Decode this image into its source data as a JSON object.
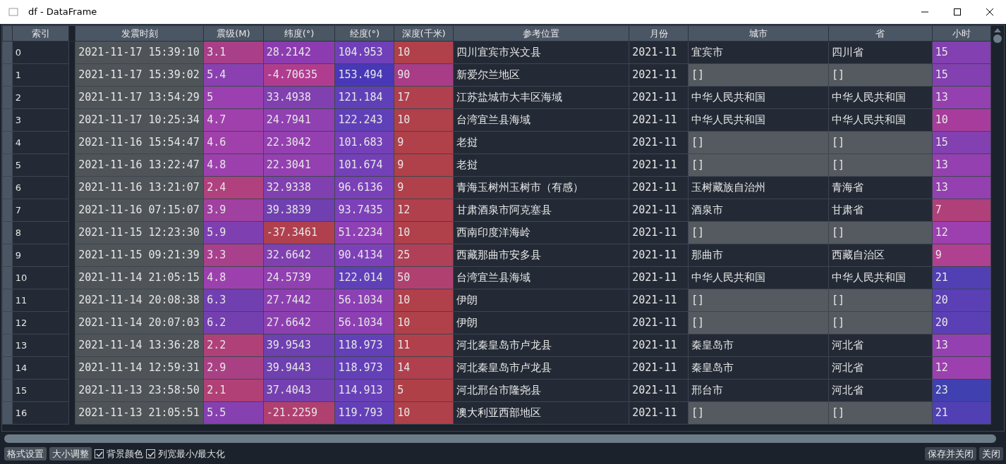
{
  "window": {
    "title": "df - DataFrame"
  },
  "index_header": "索引",
  "columns": [
    "发震时刻",
    "震级(M)",
    "纬度(°)",
    "经度(°)",
    "深度(千米)",
    "参考位置",
    "月份",
    "城市",
    "省",
    "小时"
  ],
  "rows": [
    {
      "index": "0",
      "cells": [
        {
          "text": "2021-11-17 15:39:10",
          "color": "#4e5458"
        },
        {
          "text": "3.1",
          "color": "#a83f88"
        },
        {
          "text": "28.2142",
          "color": "#8c3cb0"
        },
        {
          "text": "104.953",
          "color": "#7040b8"
        },
        {
          "text": "10",
          "color": "#b0404a"
        },
        {
          "text": "四川宜宾市兴文县",
          "color": "#232a35"
        },
        {
          "text": "2021-11",
          "color": "#232a35"
        },
        {
          "text": "宜宾市",
          "color": "#232a35"
        },
        {
          "text": "四川省",
          "color": "#232a35"
        },
        {
          "text": "15",
          "color": "#8240b0"
        }
      ]
    },
    {
      "index": "1",
      "cells": [
        {
          "text": "2021-11-17 15:39:02",
          "color": "#4e5458"
        },
        {
          "text": "5.4",
          "color": "#8a40b0"
        },
        {
          "text": "-4.70635",
          "color": "#b03c90"
        },
        {
          "text": "153.494",
          "color": "#4838b8"
        },
        {
          "text": "90",
          "color": "#a83c86"
        },
        {
          "text": "新爱尔兰地区",
          "color": "#232a35"
        },
        {
          "text": "2021-11",
          "color": "#232a35"
        },
        {
          "text": "[]",
          "color": "#545a60"
        },
        {
          "text": "[]",
          "color": "#545a60"
        },
        {
          "text": "15",
          "color": "#8240b0"
        }
      ]
    },
    {
      "index": "2",
      "cells": [
        {
          "text": "2021-11-17 13:54:29",
          "color": "#4e5458"
        },
        {
          "text": "5",
          "color": "#9a40b0"
        },
        {
          "text": "33.4938",
          "color": "#8040b0"
        },
        {
          "text": "121.184",
          "color": "#6040b8"
        },
        {
          "text": "17",
          "color": "#b0404e"
        },
        {
          "text": "江苏盐城市大丰区海域",
          "color": "#232a35"
        },
        {
          "text": "2021-11",
          "color": "#232a35"
        },
        {
          "text": "中华人民共和国",
          "color": "#232a35"
        },
        {
          "text": "中华人民共和国",
          "color": "#232a35"
        },
        {
          "text": "13",
          "color": "#9440b0"
        }
      ]
    },
    {
      "index": "3",
      "cells": [
        {
          "text": "2021-11-17 10:25:34",
          "color": "#4e5458"
        },
        {
          "text": "4.7",
          "color": "#a040ac"
        },
        {
          "text": "24.7941",
          "color": "#9040b0"
        },
        {
          "text": "122.243",
          "color": "#6040b8"
        },
        {
          "text": "10",
          "color": "#b0404a"
        },
        {
          "text": "台湾宜兰县海域",
          "color": "#232a35"
        },
        {
          "text": "2021-11",
          "color": "#232a35"
        },
        {
          "text": "中华人民共和国",
          "color": "#232a35"
        },
        {
          "text": "中华人民共和国",
          "color": "#232a35"
        },
        {
          "text": "10",
          "color": "#a83c9c"
        }
      ]
    },
    {
      "index": "4",
      "cells": [
        {
          "text": "2021-11-16 15:54:47",
          "color": "#4e5458"
        },
        {
          "text": "4.6",
          "color": "#a040aa"
        },
        {
          "text": "22.3042",
          "color": "#9440b0"
        },
        {
          "text": "101.683",
          "color": "#7440b8"
        },
        {
          "text": "9",
          "color": "#b0404a"
        },
        {
          "text": "老挝",
          "color": "#232a35"
        },
        {
          "text": "2021-11",
          "color": "#232a35"
        },
        {
          "text": "[]",
          "color": "#545a60"
        },
        {
          "text": "[]",
          "color": "#545a60"
        },
        {
          "text": "15",
          "color": "#8240b0"
        }
      ]
    },
    {
      "index": "5",
      "cells": [
        {
          "text": "2021-11-16 13:22:47",
          "color": "#4e5458"
        },
        {
          "text": "4.8",
          "color": "#9c40ae"
        },
        {
          "text": "22.3041",
          "color": "#9440b0"
        },
        {
          "text": "101.674",
          "color": "#7440b8"
        },
        {
          "text": "9",
          "color": "#b0404a"
        },
        {
          "text": "老挝",
          "color": "#232a35"
        },
        {
          "text": "2021-11",
          "color": "#232a35"
        },
        {
          "text": "[]",
          "color": "#545a60"
        },
        {
          "text": "[]",
          "color": "#545a60"
        },
        {
          "text": "13",
          "color": "#9440b0"
        }
      ]
    },
    {
      "index": "6",
      "cells": [
        {
          "text": "2021-11-16 13:21:07",
          "color": "#4e5458"
        },
        {
          "text": "2.4",
          "color": "#b0407e"
        },
        {
          "text": "32.9338",
          "color": "#8040b0"
        },
        {
          "text": "96.6136",
          "color": "#7a40b8"
        },
        {
          "text": "9",
          "color": "#b0404a"
        },
        {
          "text": "青海玉树州玉树市（有感）",
          "color": "#232a35"
        },
        {
          "text": "2021-11",
          "color": "#232a35"
        },
        {
          "text": "玉树藏族自治州",
          "color": "#232a35"
        },
        {
          "text": "青海省",
          "color": "#232a35"
        },
        {
          "text": "13",
          "color": "#9440b0"
        }
      ]
    },
    {
      "index": "7",
      "cells": [
        {
          "text": "2021-11-16 07:15:07",
          "color": "#4e5458"
        },
        {
          "text": "3.9",
          "color": "#a040a0"
        },
        {
          "text": "39.3839",
          "color": "#7040b0"
        },
        {
          "text": "93.7435",
          "color": "#7c40b8"
        },
        {
          "text": "12",
          "color": "#b0404c"
        },
        {
          "text": "甘肃酒泉市阿克塞县",
          "color": "#232a35"
        },
        {
          "text": "2021-11",
          "color": "#232a35"
        },
        {
          "text": "酒泉市",
          "color": "#232a35"
        },
        {
          "text": "甘肃省",
          "color": "#232a35"
        },
        {
          "text": "7",
          "color": "#b0407a"
        }
      ]
    },
    {
      "index": "8",
      "cells": [
        {
          "text": "2021-11-15 12:23:30",
          "color": "#4e5458"
        },
        {
          "text": "5.9",
          "color": "#7e40b0"
        },
        {
          "text": "-37.3461",
          "color": "#b0404e"
        },
        {
          "text": "51.2234",
          "color": "#8e40b4"
        },
        {
          "text": "10",
          "color": "#b0404a"
        },
        {
          "text": "西南印度洋海岭",
          "color": "#232a35"
        },
        {
          "text": "2021-11",
          "color": "#232a35"
        },
        {
          "text": "[]",
          "color": "#545a60"
        },
        {
          "text": "[]",
          "color": "#545a60"
        },
        {
          "text": "12",
          "color": "#9c40b0"
        }
      ]
    },
    {
      "index": "9",
      "cells": [
        {
          "text": "2021-11-15 09:21:39",
          "color": "#4e5458"
        },
        {
          "text": "3.3",
          "color": "#a8408c"
        },
        {
          "text": "32.6642",
          "color": "#8040b0"
        },
        {
          "text": "90.4134",
          "color": "#7e40b8"
        },
        {
          "text": "25",
          "color": "#b04058"
        },
        {
          "text": "西藏那曲市安多县",
          "color": "#232a35"
        },
        {
          "text": "2021-11",
          "color": "#232a35"
        },
        {
          "text": "那曲市",
          "color": "#232a35"
        },
        {
          "text": "西藏自治区",
          "color": "#232a35"
        },
        {
          "text": "9",
          "color": "#b04090"
        }
      ]
    },
    {
      "index": "10",
      "cells": [
        {
          "text": "2021-11-14 21:05:15",
          "color": "#4e5458"
        },
        {
          "text": "4.8",
          "color": "#9c40ae"
        },
        {
          "text": "24.5739",
          "color": "#9040b0"
        },
        {
          "text": "122.014",
          "color": "#6040b8"
        },
        {
          "text": "50",
          "color": "#b04070"
        },
        {
          "text": "台湾宜兰县海域",
          "color": "#232a35"
        },
        {
          "text": "2021-11",
          "color": "#232a35"
        },
        {
          "text": "中华人民共和国",
          "color": "#232a35"
        },
        {
          "text": "中华人民共和国",
          "color": "#232a35"
        },
        {
          "text": "21",
          "color": "#5040b4"
        }
      ]
    },
    {
      "index": "11",
      "cells": [
        {
          "text": "2021-11-14 20:08:38",
          "color": "#4e5458"
        },
        {
          "text": "6.3",
          "color": "#7040b0"
        },
        {
          "text": "27.7442",
          "color": "#8c40b0"
        },
        {
          "text": "56.1034",
          "color": "#8c40b4"
        },
        {
          "text": "10",
          "color": "#b0404a"
        },
        {
          "text": "伊朗",
          "color": "#232a35"
        },
        {
          "text": "2021-11",
          "color": "#232a35"
        },
        {
          "text": "[]",
          "color": "#545a60"
        },
        {
          "text": "[]",
          "color": "#545a60"
        },
        {
          "text": "20",
          "color": "#5a40b4"
        }
      ]
    },
    {
      "index": "12",
      "cells": [
        {
          "text": "2021-11-14 20:07:03",
          "color": "#4e5458"
        },
        {
          "text": "6.2",
          "color": "#7440b0"
        },
        {
          "text": "27.6642",
          "color": "#8c40b0"
        },
        {
          "text": "56.1034",
          "color": "#8c40b4"
        },
        {
          "text": "10",
          "color": "#b0404a"
        },
        {
          "text": "伊朗",
          "color": "#232a35"
        },
        {
          "text": "2021-11",
          "color": "#232a35"
        },
        {
          "text": "[]",
          "color": "#545a60"
        },
        {
          "text": "[]",
          "color": "#545a60"
        },
        {
          "text": "20",
          "color": "#5a40b4"
        }
      ]
    },
    {
      "index": "13",
      "cells": [
        {
          "text": "2021-11-14 13:36:28",
          "color": "#4e5458"
        },
        {
          "text": "2.2",
          "color": "#b04078"
        },
        {
          "text": "39.9543",
          "color": "#6e40b0"
        },
        {
          "text": "118.973",
          "color": "#6440b8"
        },
        {
          "text": "11",
          "color": "#b0404b"
        },
        {
          "text": "河北秦皇岛市卢龙县",
          "color": "#232a35"
        },
        {
          "text": "2021-11",
          "color": "#232a35"
        },
        {
          "text": "秦皇岛市",
          "color": "#232a35"
        },
        {
          "text": "河北省",
          "color": "#232a35"
        },
        {
          "text": "13",
          "color": "#9440b0"
        }
      ]
    },
    {
      "index": "14",
      "cells": [
        {
          "text": "2021-11-14 12:59:31",
          "color": "#4e5458"
        },
        {
          "text": "2.9",
          "color": "#aa4084"
        },
        {
          "text": "39.9443",
          "color": "#6e40b0"
        },
        {
          "text": "118.973",
          "color": "#6440b8"
        },
        {
          "text": "14",
          "color": "#b0404d"
        },
        {
          "text": "河北秦皇岛市卢龙县",
          "color": "#232a35"
        },
        {
          "text": "2021-11",
          "color": "#232a35"
        },
        {
          "text": "秦皇岛市",
          "color": "#232a35"
        },
        {
          "text": "河北省",
          "color": "#232a35"
        },
        {
          "text": "12",
          "color": "#9c40b0"
        }
      ]
    },
    {
      "index": "15",
      "cells": [
        {
          "text": "2021-11-13 23:58:50",
          "color": "#4e5458"
        },
        {
          "text": "2.1",
          "color": "#b04076"
        },
        {
          "text": "37.4043",
          "color": "#7440b0"
        },
        {
          "text": "114.913",
          "color": "#6840b8"
        },
        {
          "text": "5",
          "color": "#b04048"
        },
        {
          "text": "河北邢台市隆尧县",
          "color": "#232a35"
        },
        {
          "text": "2021-11",
          "color": "#232a35"
        },
        {
          "text": "邢台市",
          "color": "#232a35"
        },
        {
          "text": "河北省",
          "color": "#232a35"
        },
        {
          "text": "23",
          "color": "#4040b0"
        }
      ]
    },
    {
      "index": "16",
      "cells": [
        {
          "text": "2021-11-13 21:05:51",
          "color": "#4e5458"
        },
        {
          "text": "5.5",
          "color": "#8640b0"
        },
        {
          "text": "-21.2259",
          "color": "#b04070"
        },
        {
          "text": "119.793",
          "color": "#6440b8"
        },
        {
          "text": "10",
          "color": "#b0404a"
        },
        {
          "text": "澳大利亚西部地区",
          "color": "#232a35"
        },
        {
          "text": "2021-11",
          "color": "#232a35"
        },
        {
          "text": "[]",
          "color": "#545a60"
        },
        {
          "text": "[]",
          "color": "#545a60"
        },
        {
          "text": "21",
          "color": "#5040b4"
        }
      ]
    }
  ],
  "toolbar": {
    "buttons": [
      "格式设置",
      "大小调整"
    ],
    "checkboxes": [
      {
        "label": "背景颜色",
        "checked": true
      },
      {
        "label": "列宽最小/最大化",
        "checked": true
      }
    ],
    "actions": [
      "保存并关闭",
      "关闭"
    ]
  }
}
